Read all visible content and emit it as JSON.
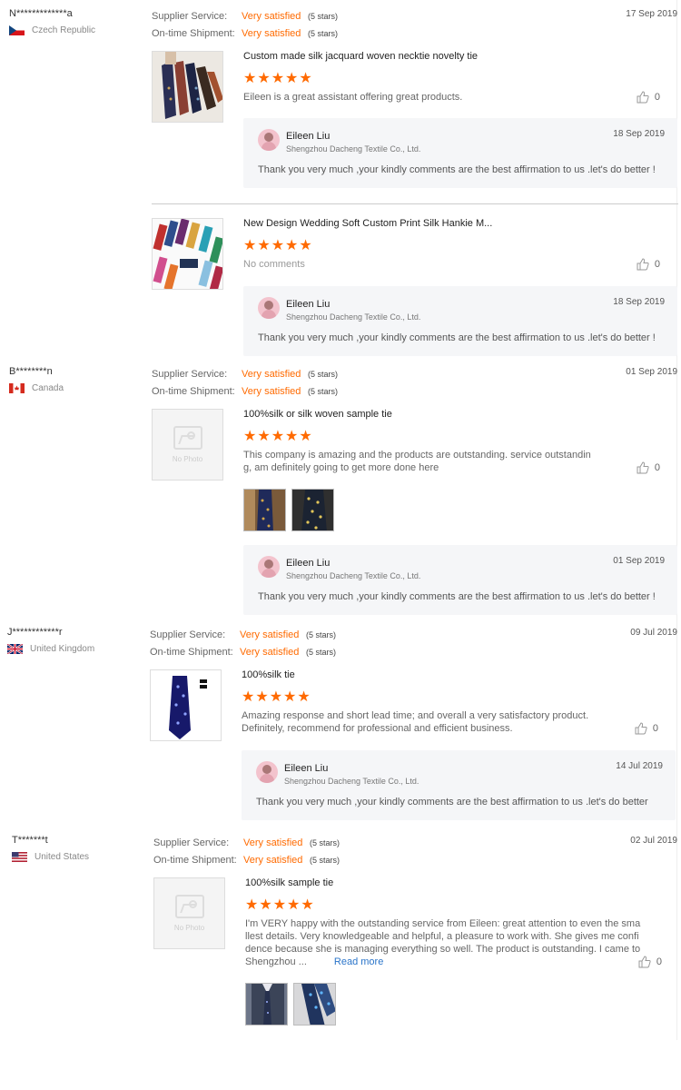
{
  "labels": {
    "supplier_service": "Supplier Service:",
    "on_time_shipment": "On-time Shipment:",
    "no_photo": "No Photo"
  },
  "reply_common": {
    "name": "Eileen Liu",
    "company": "Shengzhou Dacheng Textile Co., Ltd.",
    "text": "Thank you very much ,your kindly comments are the  best affirmation  to us .let's do better !",
    "text_short": "Thank you very much ,your kindly comments are the  best affirmation  to us .let's do better"
  },
  "reviews": [
    {
      "buyer": "N*************a",
      "country": "Czech Republic",
      "date": "17 Sep 2019",
      "supplier_service": "Very satisfied",
      "supplier_service_stars": "(5 stars)",
      "shipment": "Very satisfied",
      "shipment_stars": "(5 stars)",
      "products": [
        {
          "name": "Custom made silk jacquard woven necktie novelty tie",
          "stars": "★★★★★",
          "comment": "Eileen is a great assistant offering great products.",
          "likes": "0",
          "reply_date": "18 Sep 2019"
        },
        {
          "name": "New Design Wedding Soft Custom Print Silk Hankie M...",
          "stars": "★★★★★",
          "comment": "No comments",
          "likes": "0",
          "reply_date": "18 Sep 2019"
        }
      ]
    },
    {
      "buyer": "B********n",
      "country": "Canada",
      "date": "01 Sep 2019",
      "supplier_service": "Very satisfied",
      "supplier_service_stars": "(5 stars)",
      "shipment": "Very satisfied",
      "shipment_stars": "(5 stars)",
      "products": [
        {
          "name": "100%silk or silk woven sample tie",
          "stars": "★★★★★",
          "comment_line1": "This company is amazing and the products are outstanding. service outstandin",
          "comment_line2": "g, am definitely going to get more done here",
          "likes": "0",
          "reply_date": "01 Sep 2019"
        }
      ]
    },
    {
      "buyer": "J************r",
      "country": "United Kingdom",
      "date": "09 Jul 2019",
      "supplier_service": "Very satisfied",
      "supplier_service_stars": "(5 stars)",
      "shipment": "Very satisfied",
      "shipment_stars": "(5 stars)",
      "products": [
        {
          "name": "100%silk tie",
          "stars": "★★★★★",
          "comment_line1": "Amazing response and short lead time; and overall a very satisfactory product.",
          "comment_line2": "Definitely, recommend for professional and efficient business.",
          "likes": "0",
          "reply_date": "14 Jul 2019"
        }
      ]
    },
    {
      "buyer": "T*******t",
      "country": "United States",
      "date": "02 Jul 2019",
      "supplier_service": "Very satisfied",
      "supplier_service_stars": "(5 stars)",
      "shipment": "Very satisfied",
      "shipment_stars": "(5 stars)",
      "products": [
        {
          "name": "100%silk sample tie",
          "stars": "★★★★★",
          "comment_line1": "I'm VERY happy with the outstanding service from Eileen: great attention to even the sma",
          "comment_line2": "llest details. Very knowledgeable and helpful, a pleasure to work with. She gives me confi",
          "comment_line3": "dence because she is managing everything so well. The product is outstanding. I came to",
          "comment_line4": "Shengzhou ...",
          "read_more": "Read more",
          "likes": "0"
        }
      ]
    }
  ]
}
